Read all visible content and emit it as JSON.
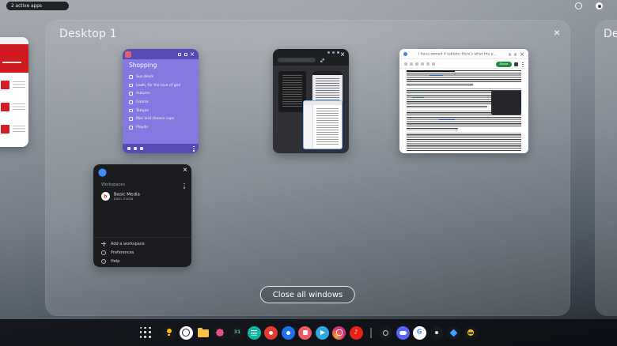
{
  "status": {
    "active_apps_label": "2 active apps"
  },
  "icons": {
    "close": "×"
  },
  "overview": {
    "desktop1": {
      "title": "Desktop 1",
      "close_all_label": "Close all windows",
      "windows": {
        "shopping": {
          "title": "Shopping",
          "items": [
            "Sun block",
            "Leafs, for the love of god",
            "Autumn",
            "Cereza",
            "Temple",
            "Mac and cheese cups",
            "Playdo"
          ]
        },
        "article": {
          "title": "I have owned X tablets: Here's what the p...",
          "action_label": "Share"
        },
        "workspace": {
          "header": "Workspaces",
          "account_name": "Basic Media",
          "account_url": "basic.media",
          "avatar_glyph": "b",
          "menu": [
            "Add a workspace",
            "Preferences",
            "Help"
          ]
        }
      }
    },
    "desktop2": {
      "title": "Des"
    }
  },
  "taskbar": {
    "calendar_day": "31",
    "google_glyph": "G",
    "music_glyph": "♪",
    "apps": [
      "launcher",
      "keep",
      "clock",
      "files",
      "photos",
      "calendar",
      "teal-app",
      "red-app",
      "blue-app",
      "coral-app",
      "telegram",
      "camera-app",
      "music",
      "dark-app-1",
      "discord",
      "google",
      "dark-app-2",
      "blue-diamond-app",
      "bee-app"
    ]
  },
  "colors": {
    "accent_blue": "#8ab4f8",
    "purple_app": "#8478e1",
    "green_button": "#1e8e3e",
    "taskbar_bg": "#0a0d11"
  }
}
